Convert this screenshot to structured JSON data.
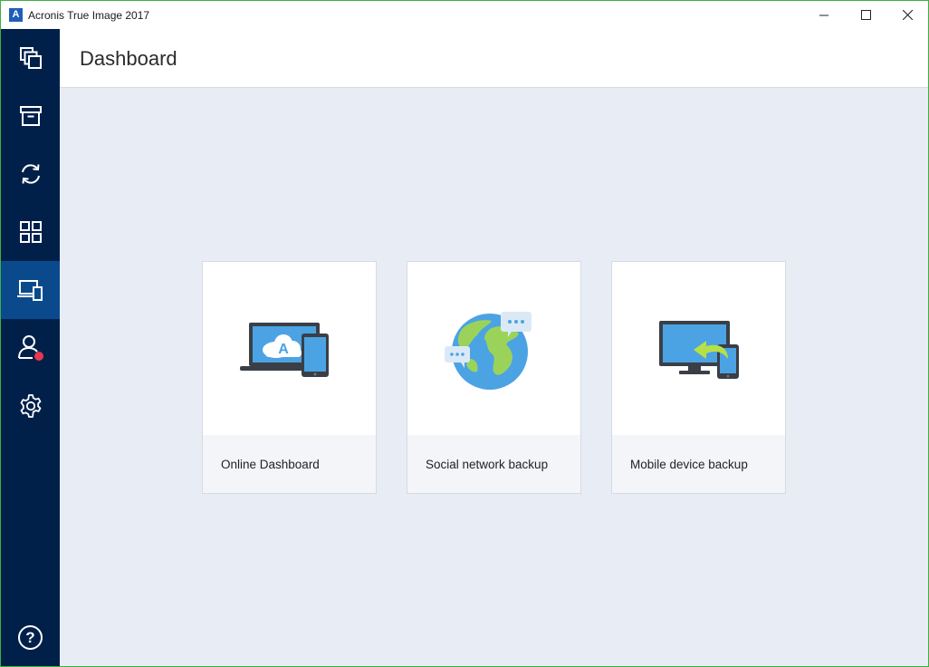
{
  "window": {
    "title": "Acronis True Image 2017",
    "logo_letter": "A"
  },
  "sidebar": {
    "items": [
      {
        "icon": "backup-icon",
        "active": false
      },
      {
        "icon": "archive-icon",
        "active": false
      },
      {
        "icon": "sync-icon",
        "active": false
      },
      {
        "icon": "tools-icon",
        "active": false
      },
      {
        "icon": "dashboard-icon",
        "active": true
      },
      {
        "icon": "account-icon",
        "active": false
      },
      {
        "icon": "settings-icon",
        "active": false
      },
      {
        "icon": "help-icon",
        "active": false
      }
    ],
    "help_label": "?"
  },
  "header": {
    "title": "Dashboard"
  },
  "cards": [
    {
      "label": "Online Dashboard",
      "icon": "online-dashboard-icon",
      "art_letter": "A"
    },
    {
      "label": "Social network backup",
      "icon": "globe-icon"
    },
    {
      "label": "Mobile device backup",
      "icon": "mobile-backup-icon"
    }
  ],
  "colors": {
    "sidebar": "#00204a",
    "sidebar_active": "#0a4a8c",
    "content_bg": "#e8ecf4",
    "notification_dot": "#e8384f",
    "window_border": "#3cb043"
  }
}
